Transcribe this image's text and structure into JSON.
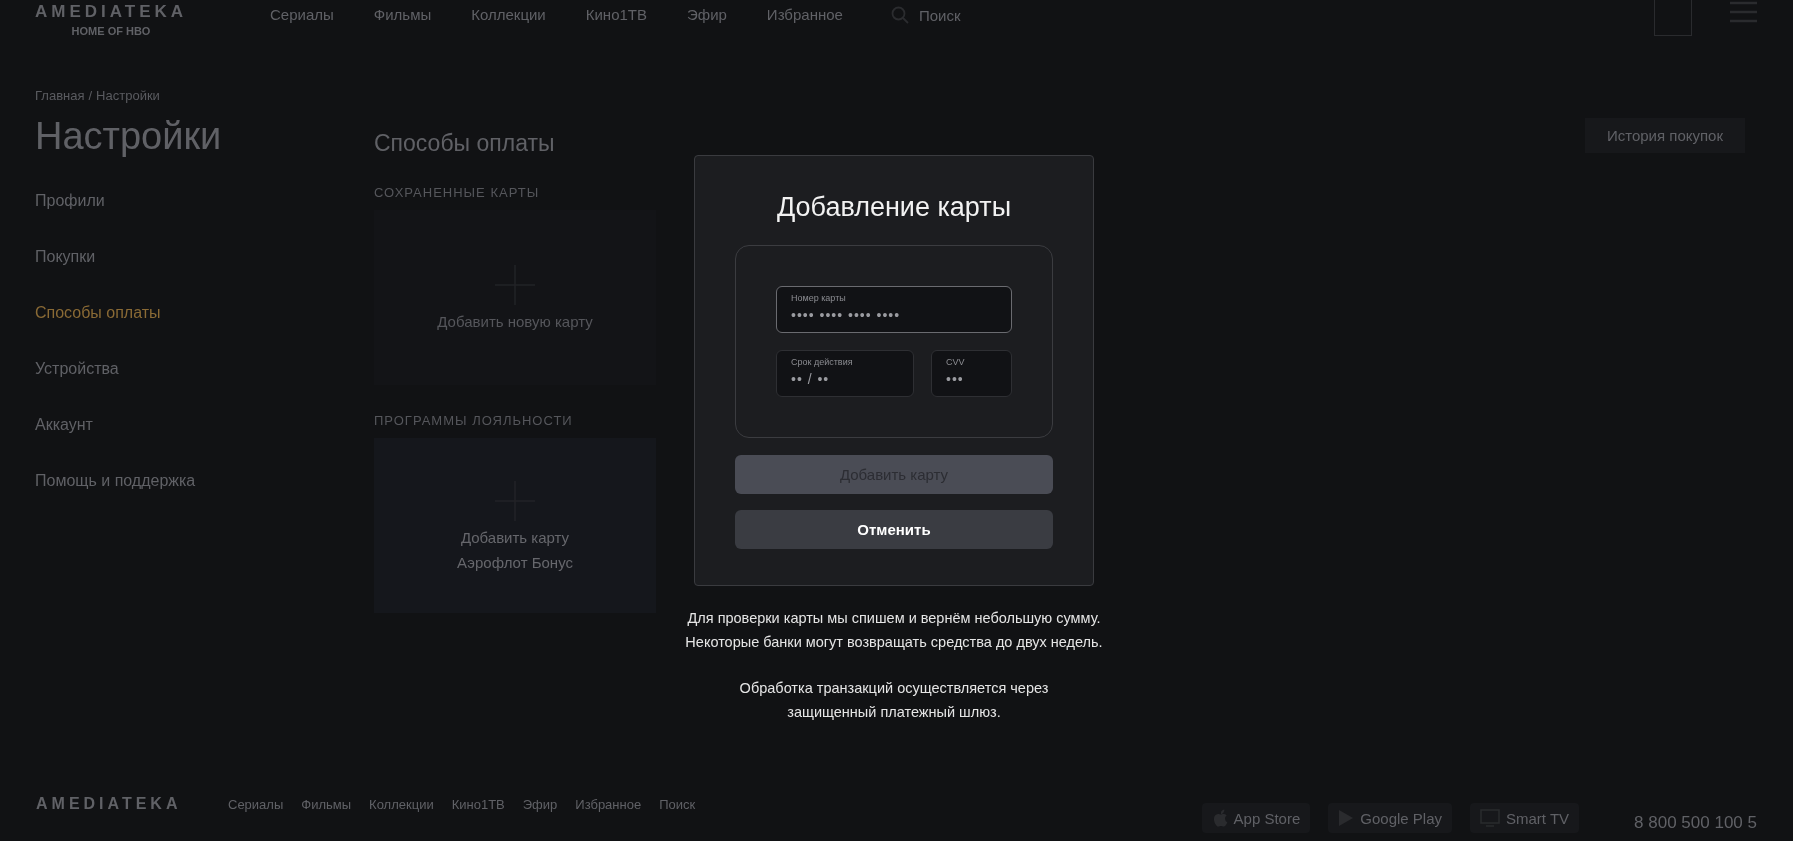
{
  "header": {
    "logo": "AMEDIATEKA",
    "logo_tagline": "HOME OF HBO",
    "nav": [
      "Сериалы",
      "Фильмы",
      "Коллекции",
      "Кино1ТВ",
      "Эфир",
      "Избранное"
    ],
    "search": "Поиск"
  },
  "breadcrumb": {
    "items": [
      "Главная",
      "Настройки"
    ],
    "separator": "/"
  },
  "page_title": "Настройки",
  "sidebar": {
    "items": [
      {
        "label": "Профили",
        "selected": false
      },
      {
        "label": "Покупки",
        "selected": false
      },
      {
        "label": "Способы оплаты",
        "selected": true
      },
      {
        "label": "Устройства",
        "selected": false
      },
      {
        "label": "Аккаунт",
        "selected": false
      },
      {
        "label": "Помощь и поддержка",
        "selected": false
      }
    ]
  },
  "content": {
    "title": "Способы оплаты",
    "history_button": "История покупок",
    "sections": [
      {
        "heading": "СОХРАНЕННЫЕ КАРТЫ",
        "cards": [
          {
            "label_lines": [
              "Добавить новую карту"
            ],
            "highlight": false
          }
        ]
      },
      {
        "heading": "ПРОГРАММЫ ЛОЯЛЬНОСТИ",
        "cards": [
          {
            "label_lines": [
              "Добавить карту",
              "Аэрофлот Бонус"
            ],
            "highlight": true
          }
        ]
      }
    ]
  },
  "modal": {
    "title": "Добавление карты",
    "fields": [
      {
        "label": "Номер карты",
        "placeholder": "•••• •••• •••• ••••",
        "focused": true,
        "kind": "wide"
      },
      {
        "label": "Срок действия",
        "placeholder": "•• / ••",
        "focused": false,
        "kind": "medium"
      },
      {
        "label": "CVV",
        "placeholder": "•••",
        "focused": false,
        "kind": "small"
      }
    ],
    "buttons": [
      {
        "label": "Добавить карту",
        "disabled": true
      },
      {
        "label": "Отменить",
        "disabled": false
      }
    ],
    "notes": [
      [
        "Для проверки карты мы спишем и вернём небольшую сумму.",
        "Некоторые банки могут возвращать средства до двух недель."
      ],
      [
        "Обработка транзакций осуществляется через",
        "защищенный платежный шлюз."
      ]
    ]
  },
  "footer": {
    "logo": "AMEDIATEKA",
    "nav": [
      "Сериалы",
      "Фильмы",
      "Коллекции",
      "Кино1ТВ",
      "Эфир",
      "Избранное",
      "Поиск"
    ],
    "stores": [
      {
        "name": "App Store",
        "kind": "apple"
      },
      {
        "name": "Google Play",
        "kind": "play"
      },
      {
        "name": "Smart TV",
        "kind": "tv"
      }
    ],
    "phone": "8 800 500 100 5"
  }
}
